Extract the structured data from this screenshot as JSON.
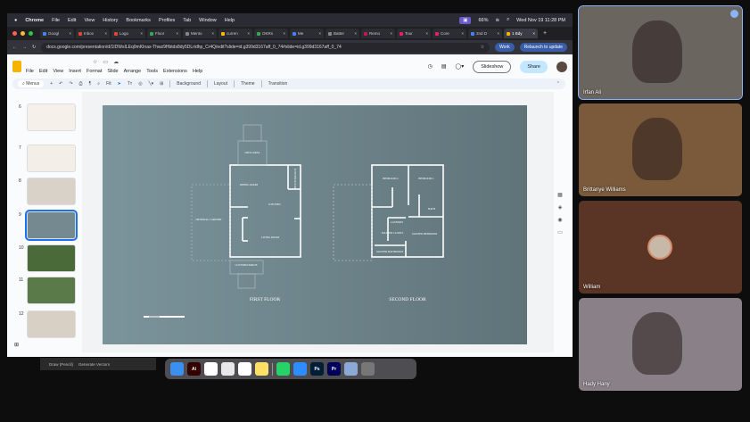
{
  "menubar": {
    "app": "Chrome",
    "items": [
      "File",
      "Edit",
      "View",
      "History",
      "Bookmarks",
      "Profiles",
      "Tab",
      "Window",
      "Help"
    ],
    "battery": "66%",
    "clock": "Wed Nov 19  11:28 PM"
  },
  "tabs": [
    {
      "label": "Googl",
      "color": "#4285f4"
    },
    {
      "label": "Inbox",
      "color": "#ea4335"
    },
    {
      "label": "Logo",
      "color": "#ea4335"
    },
    {
      "label": "Floor",
      "color": "#34a853"
    },
    {
      "label": "Mento",
      "color": "#888888"
    },
    {
      "label": "curren",
      "color": "#fbbc05"
    },
    {
      "label": "OKRs",
      "color": "#34a853"
    },
    {
      "label": "Me",
      "color": "#4285f4"
    },
    {
      "label": "Batter",
      "color": "#888888"
    },
    {
      "label": "Remo",
      "color": "#c2185b"
    },
    {
      "label": "Tour",
      "color": "#e91e63"
    },
    {
      "label": "Core",
      "color": "#e91e63"
    },
    {
      "label": "2nd D",
      "color": "#4285f4"
    },
    {
      "label": "1 Bdy",
      "color": "#f4b400",
      "active": true
    }
  ],
  "address": {
    "url": "docs.google.com/presentation/d/1IDWsILEq0mKInax-Thwz9Hbtds8dy5DLridhp_Cr4Q/edit?slide=id.g399d3167aff_0_74#slide=id.g399d3167aff_0_74",
    "profile": "Work",
    "relaunch": "Relaunch to update"
  },
  "docs": {
    "menus": [
      "File",
      "Edit",
      "View",
      "Insert",
      "Format",
      "Slide",
      "Arrange",
      "Tools",
      "Extensions",
      "Help"
    ],
    "slideshow": "Slideshow",
    "share": "Share"
  },
  "toolbar": {
    "search": "Menus",
    "zoom": "Fit",
    "background": "Background",
    "layout": "Layout",
    "theme": "Theme",
    "transition": "Transition"
  },
  "filmstrip": [
    {
      "num": "6"
    },
    {
      "num": "7"
    },
    {
      "num": "8"
    },
    {
      "num": "9",
      "selected": true
    },
    {
      "num": "10"
    },
    {
      "num": "11"
    },
    {
      "num": "12"
    }
  ],
  "slide": {
    "first_floor": {
      "title": "FIRST FLOOR",
      "rooms": [
        "DECK AREA",
        "DINING ROOM",
        "KITCHEN",
        "LIVING ROOM",
        "POWDER ROOM",
        "OPTIONAL CARPORT",
        "COVERED PORCH"
      ]
    },
    "second_floor": {
      "title": "SECOND FLOOR",
      "rooms": [
        "BEDROOM 2",
        "BEDROOM 1",
        "BATH",
        "LAUNDRY",
        "MASTER CLOSET",
        "MASTER BEDROOM",
        "MASTER BATHROOM"
      ]
    }
  },
  "drawbar": {
    "draw": "Draw (Pencil)",
    "generate": "Generate Vectors"
  },
  "dock": [
    {
      "name": "Finder",
      "color": "#3b8ff0",
      "label": ""
    },
    {
      "name": "Illustrator",
      "color": "#330000",
      "label": "Ai"
    },
    {
      "name": "Slack",
      "color": "#ffffff",
      "label": ""
    },
    {
      "name": "Chrome",
      "color": "#e8e8e8",
      "label": ""
    },
    {
      "name": "ChatGPT",
      "color": "#ffffff",
      "label": ""
    },
    {
      "name": "Notes",
      "color": "#ffe066",
      "label": ""
    },
    {
      "name": "WhatsApp",
      "color": "#25d366",
      "label": ""
    },
    {
      "name": "Zoom",
      "color": "#2d8cff",
      "label": ""
    },
    {
      "name": "Photoshop",
      "color": "#001e36",
      "label": "Ps"
    },
    {
      "name": "Premiere",
      "color": "#00005b",
      "label": "Pr"
    },
    {
      "name": "Preview",
      "color": "#8aa9d6",
      "label": ""
    }
  ],
  "participants": [
    {
      "name": "Irfan Ali",
      "bg": "#6b6560",
      "speaking": true
    },
    {
      "name": "Brittanye Williams",
      "bg": "#7a5a3a"
    },
    {
      "name": "William",
      "bg": "#5a3424"
    },
    {
      "name": "Hady Hany",
      "bg": "#8a8088"
    }
  ]
}
